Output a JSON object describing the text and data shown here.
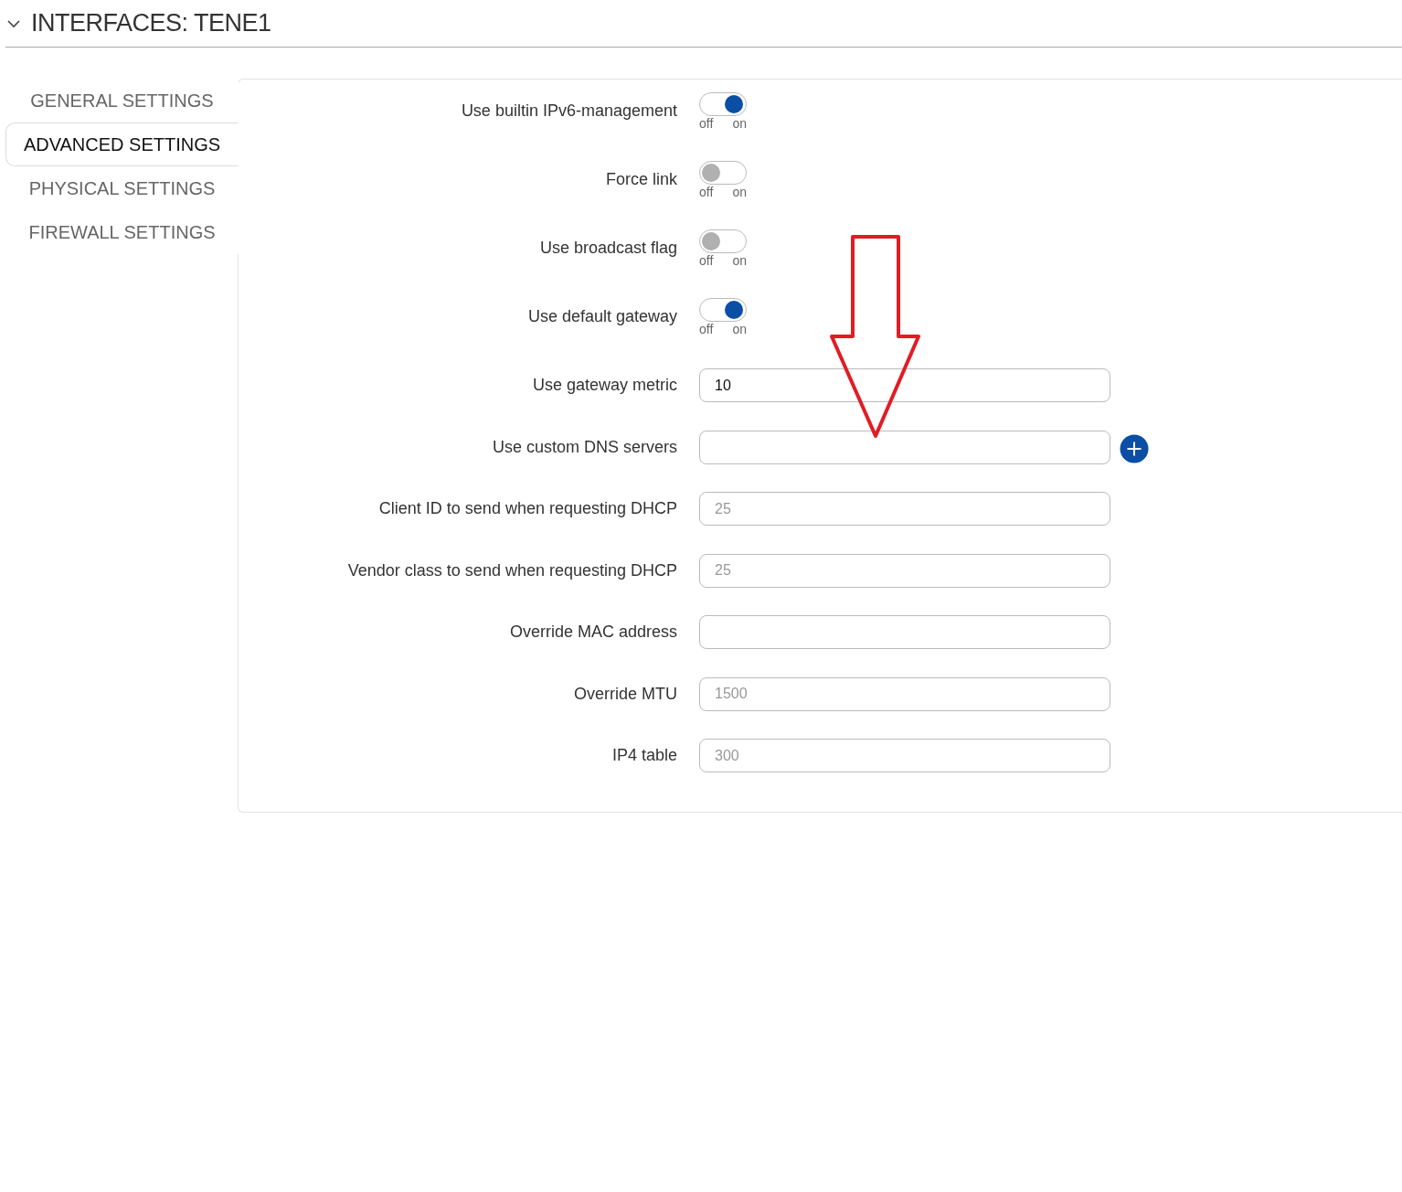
{
  "section": {
    "title": "INTERFACES: TENE1",
    "expanded": true
  },
  "tabs": [
    {
      "label": "GENERAL SETTINGS",
      "selected": false
    },
    {
      "label": "ADVANCED SETTINGS",
      "selected": true
    },
    {
      "label": "PHYSICAL SETTINGS",
      "selected": false
    },
    {
      "label": "FIREWALL SETTINGS",
      "selected": false
    }
  ],
  "fields": [
    {
      "kind": "toggle",
      "label": "Use builtin IPv6-management",
      "on": true,
      "off_label": "off",
      "on_label": "on"
    },
    {
      "kind": "toggle",
      "label": "Force link",
      "on": false,
      "off_label": "off",
      "on_label": "on"
    },
    {
      "kind": "toggle",
      "label": "Use broadcast flag",
      "on": false,
      "off_label": "off",
      "on_label": "on"
    },
    {
      "kind": "toggle",
      "label": "Use default gateway",
      "on": true,
      "off_label": "off",
      "on_label": "on"
    },
    {
      "kind": "input",
      "label": "Use gateway metric",
      "value": "10"
    },
    {
      "kind": "input",
      "label": "Use custom DNS servers",
      "add_button": true
    },
    {
      "kind": "input",
      "label": "Client ID to send when requesting DHCP",
      "placeholder": "25"
    },
    {
      "kind": "input",
      "label": "Vendor class to send when requesting DHCP",
      "placeholder": "25"
    },
    {
      "kind": "input",
      "label": "Override MAC address"
    },
    {
      "kind": "input",
      "label": "Override MTU",
      "placeholder": "1500"
    },
    {
      "kind": "input",
      "label": "IP4 table",
      "placeholder": "300"
    }
  ]
}
